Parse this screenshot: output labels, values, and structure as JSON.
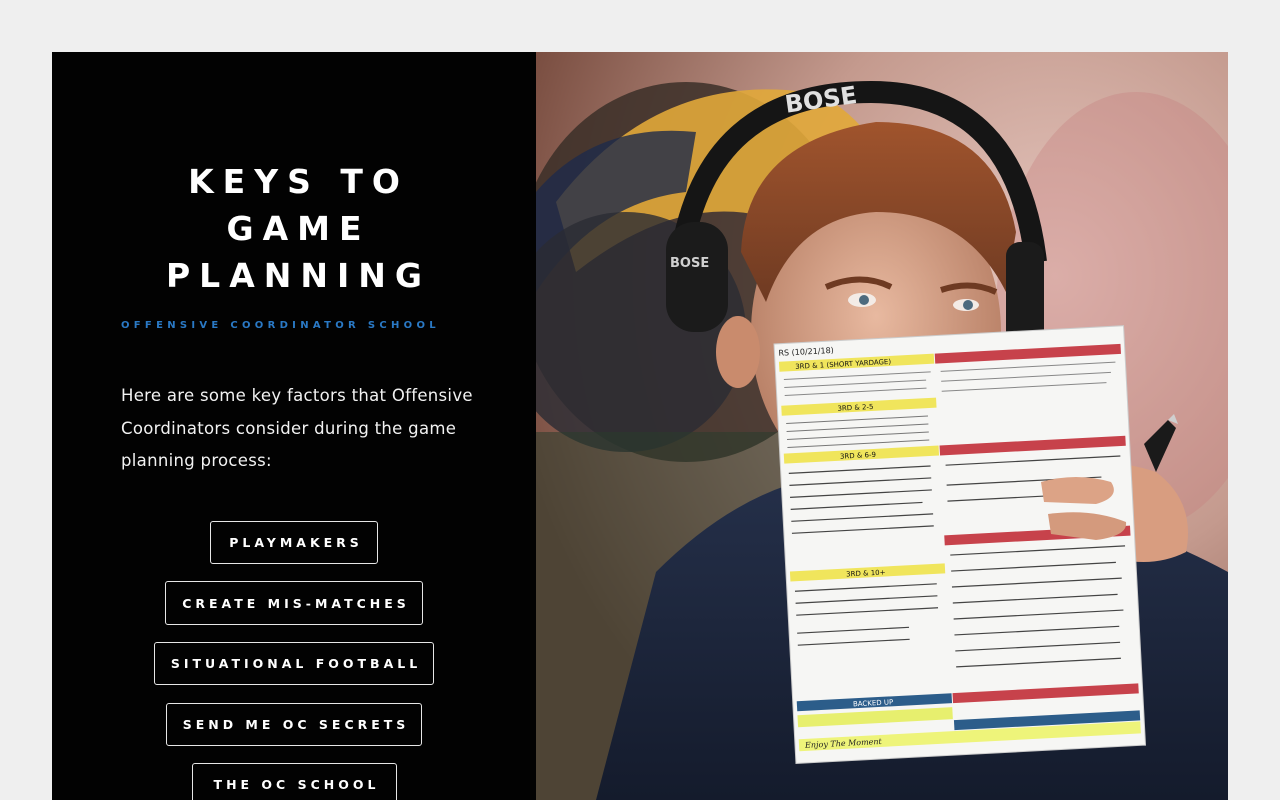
{
  "hero": {
    "title_lines": [
      "KEYS TO",
      "GAME",
      "PLANNING"
    ],
    "subtitle": "OFFENSIVE COORDINATOR SCHOOL",
    "intro": "Here are some key factors that Offensive Coordinators consider during the game planning process:"
  },
  "buttons": {
    "playmakers": "PLAYMAKERS",
    "mismatches": "CREATE MIS-MATCHES",
    "situational": "SITUATIONAL FOOTBALL",
    "secrets": "SEND ME OC SECRETS",
    "school": "THE OC SCHOOL"
  },
  "photo": {
    "headset_brand": "BOSE",
    "headset_brand_side": "BOSE",
    "call_sheet": {
      "header": "RS (10/21/18)",
      "sections": [
        "3RD & 1 (SHORT YARDAGE)",
        "3RD & 2-5",
        "3RD & 6-9",
        "3RD & 10+",
        "BACKED UP"
      ],
      "footer": "Enjoy The Moment"
    }
  },
  "colors": {
    "panel_bg": "#020202",
    "page_bg": "#efefef",
    "accent": "#2a79c5"
  }
}
